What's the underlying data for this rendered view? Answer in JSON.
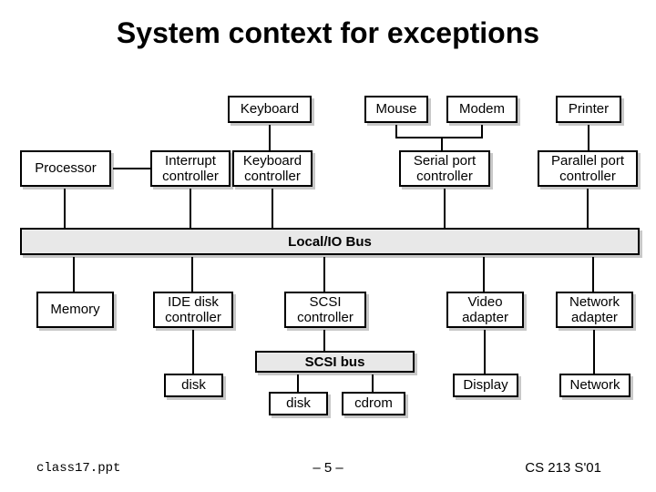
{
  "title": "System context for exceptions",
  "row1": {
    "keyboard": "Keyboard",
    "mouse": "Mouse",
    "modem": "Modem",
    "printer": "Printer"
  },
  "row2": {
    "processor": "Processor",
    "interrupt_controller": "Interrupt\ncontroller",
    "keyboard_controller": "Keyboard\ncontroller",
    "serial_port_controller": "Serial port\ncontroller",
    "parallel_port_controller": "Parallel port\ncontroller"
  },
  "bus": "Local/IO Bus",
  "row3": {
    "memory": "Memory",
    "ide_disk_controller": "IDE disk\ncontroller",
    "scsi_controller": "SCSI\ncontroller",
    "video_adapter": "Video\nadapter",
    "network_adapter": "Network\nadapter"
  },
  "scsi_bus": "SCSI bus",
  "row4": {
    "disk1": "disk",
    "disk2": "disk",
    "cdrom": "cdrom",
    "display": "Display",
    "network": "Network"
  },
  "footer": {
    "file": "class17.ppt",
    "page": "– 5 –",
    "course": "CS 213 S'01"
  }
}
